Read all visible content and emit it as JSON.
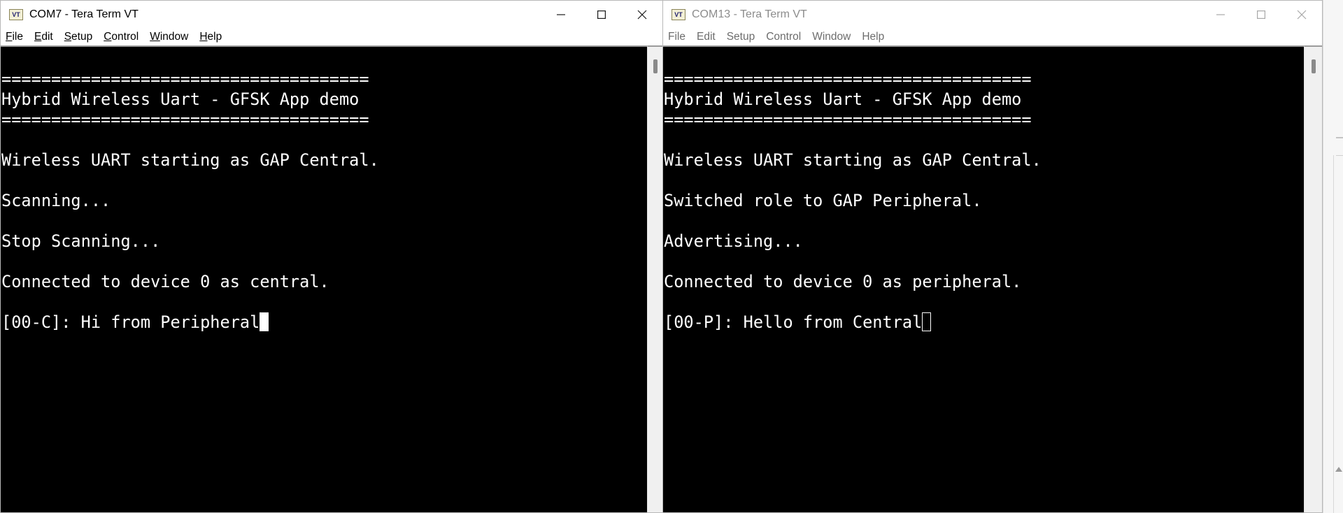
{
  "windows": [
    {
      "title": "COM7 - Tera Term VT",
      "app_icon_text": "VT",
      "active": true,
      "menu": {
        "items": [
          {
            "label": "File",
            "access_key": "F",
            "rest": "ile"
          },
          {
            "label": "Edit",
            "access_key": "E",
            "rest": "dit"
          },
          {
            "label": "Setup",
            "access_key": "S",
            "rest": "etup"
          },
          {
            "label": "Control",
            "access_key": "C",
            "rest": "ontrol"
          },
          {
            "label": "Window",
            "access_key": "W",
            "rest": "indow"
          },
          {
            "label": "Help",
            "access_key": "H",
            "rest": "elp"
          }
        ]
      },
      "terminal": {
        "lines": [
          "=====================================",
          "Hybrid Wireless Uart - GFSK App demo",
          "=====================================",
          "",
          "Wireless UART starting as GAP Central.",
          "",
          "Scanning...",
          "",
          "Stop Scanning...",
          "",
          "Connected to device 0 as central.",
          "",
          "[00-C]: Hi from Peripheral"
        ],
        "cursor": "block"
      },
      "controls": {
        "minimize": "minimize-icon",
        "maximize": "maximize-icon",
        "close": "close-icon"
      }
    },
    {
      "title": "COM13 - Tera Term VT",
      "app_icon_text": "VT",
      "active": false,
      "menu": {
        "items": [
          {
            "label": "File"
          },
          {
            "label": "Edit"
          },
          {
            "label": "Setup"
          },
          {
            "label": "Control"
          },
          {
            "label": "Window"
          },
          {
            "label": "Help"
          }
        ]
      },
      "terminal": {
        "lines": [
          "=====================================",
          "Hybrid Wireless Uart - GFSK App demo",
          "=====================================",
          "",
          "Wireless UART starting as GAP Central.",
          "",
          "Switched role to GAP Peripheral.",
          "",
          "Advertising...",
          "",
          "Connected to device 0 as peripheral.",
          "",
          "[00-P]: Hello from Central"
        ],
        "cursor": "outline"
      },
      "controls": {
        "minimize": "minimize-icon",
        "maximize": "maximize-icon",
        "close": "close-icon"
      }
    }
  ],
  "colors": {
    "terminal_background": "#000000",
    "terminal_text": "#ffffff",
    "inactive_title": "#8c8c8c"
  }
}
